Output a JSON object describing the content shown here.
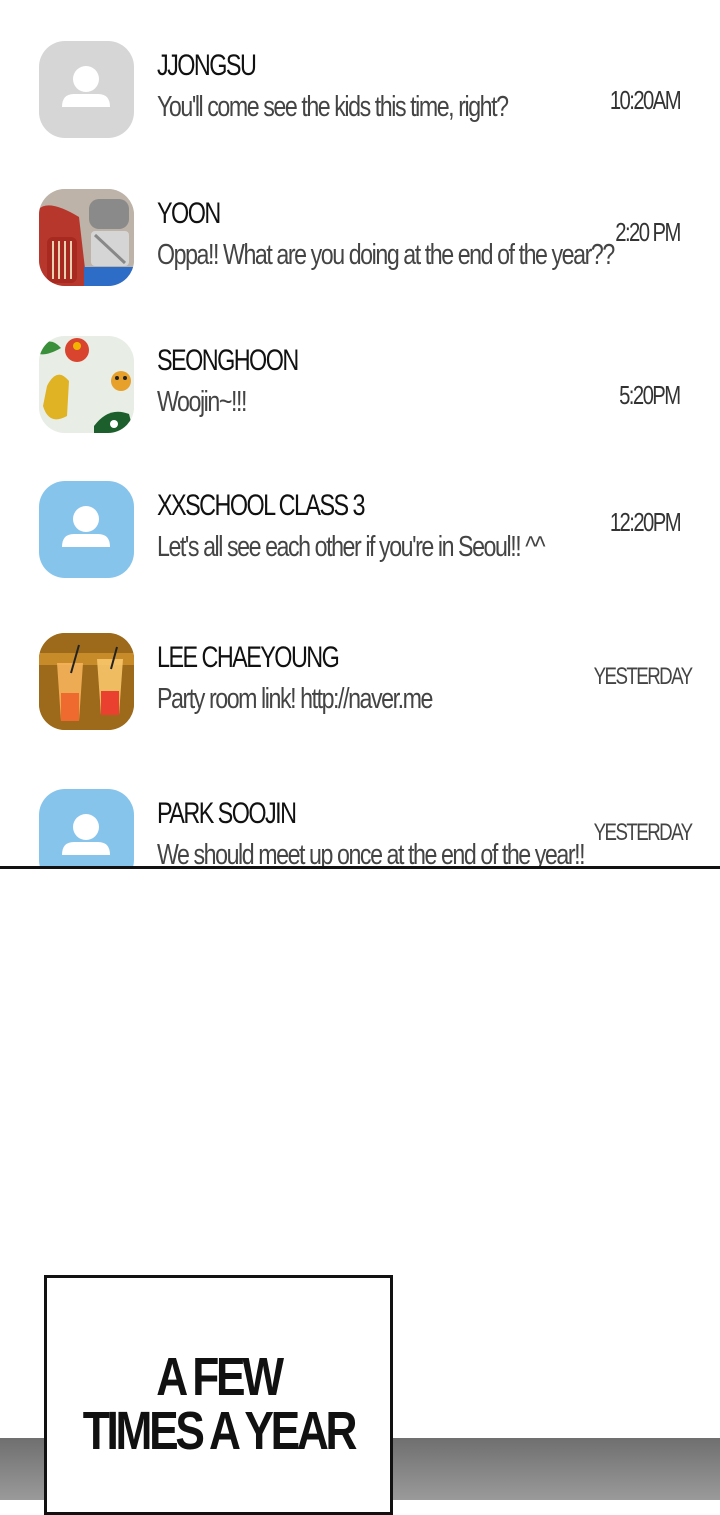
{
  "chats": [
    {
      "name": "JJONGSU",
      "message": "You'll come see the kids this time, right?",
      "time": "10:20AM",
      "avatar": "default-gray-icon"
    },
    {
      "name": "YOON",
      "message": "Oppa!! What are you doing at the end of the year??",
      "time": "2:20 PM",
      "avatar": "red-machine-photo"
    },
    {
      "name": "SEONGHOON",
      "message": "Woojin~!!!",
      "time": "5:20PM",
      "avatar": "toys-photo"
    },
    {
      "name": "XXSCHOOL CLASS 3",
      "message": "Let's all see each other if you're in Seoul!! ^^",
      "time": "12:20PM",
      "avatar": "default-blue-icon"
    },
    {
      "name": "LEE CHAEYOUNG",
      "message": "Party room link! http://naver.me",
      "time": "YESTERDAY",
      "avatar": "drinks-photo"
    },
    {
      "name": "PARK SOOJIN",
      "message": "We should meet up once at the end of the year!!",
      "time": "YESTERDAY",
      "avatar": "default-blue-icon"
    }
  ],
  "caption": {
    "line1": "A FEW",
    "line2": "TIMES A YEAR"
  },
  "colors": {
    "default_gray": "#d6d6d6",
    "default_blue": "#86c4ec",
    "border": "#111111"
  }
}
